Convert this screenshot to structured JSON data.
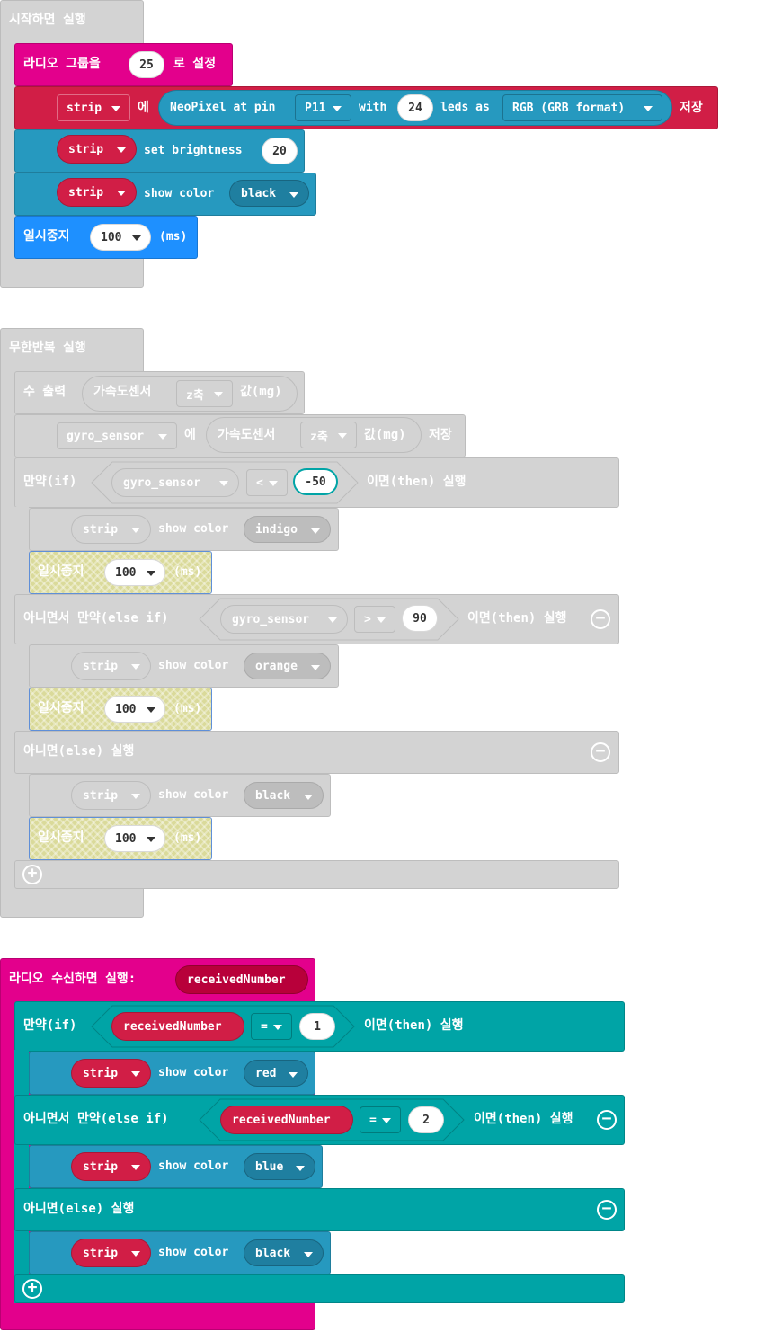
{
  "start_block": {
    "title": "시작하면 실행",
    "radio_group": {
      "label": "라디오 그룹을",
      "value": "25",
      "suffix": "로 설정"
    },
    "neopixel": {
      "var": "strip",
      "to": "에",
      "create": "NeoPixel at pin",
      "pin": "P11",
      "with": "with",
      "count": "24",
      "leds_as": "leds as",
      "format": "RGB (GRB format)",
      "store": "저장"
    },
    "brightness": {
      "var": "strip",
      "text": "set brightness",
      "value": "20"
    },
    "show_color": {
      "var": "strip",
      "text": "show color",
      "color": "black"
    },
    "pause": {
      "label": "일시중지",
      "value": "100",
      "unit": "(ms)"
    }
  },
  "forever_block": {
    "title": "무한반복 실행",
    "print": {
      "label": "수 출력",
      "sensor": "가속도센서",
      "axis": "z축",
      "unit": "값(mg)"
    },
    "assign": {
      "var": "gyro_sensor",
      "to": "에",
      "sensor": "가속도센서",
      "axis": "z축",
      "unit": "값(mg)",
      "store": "저장"
    },
    "if": {
      "label": "만약(if)",
      "var": "gyro_sensor",
      "op": "<",
      "value": "-50",
      "then": "이면(then) 실행"
    },
    "if_color": {
      "var": "strip",
      "text": "show color",
      "color": "indigo"
    },
    "pause1": {
      "label": "일시중지",
      "value": "100",
      "unit": "(ms)"
    },
    "elseif": {
      "label": "아니면서 만약(else if)",
      "var": "gyro_sensor",
      "op": ">",
      "value": "90",
      "then": "이면(then) 실행"
    },
    "elseif_color": {
      "var": "strip",
      "text": "show color",
      "color": "orange"
    },
    "pause2": {
      "label": "일시중지",
      "value": "100",
      "unit": "(ms)"
    },
    "else": {
      "label": "아니면(else) 실행"
    },
    "else_color": {
      "var": "strip",
      "text": "show color",
      "color": "black"
    },
    "pause3": {
      "label": "일시중지",
      "value": "100",
      "unit": "(ms)"
    }
  },
  "radio_block": {
    "title": "라디오 수신하면 실행:",
    "param": "receivedNumber",
    "if": {
      "label": "만약(if)",
      "var": "receivedNumber",
      "op": "=",
      "value": "1",
      "then": "이면(then) 실행"
    },
    "if_color": {
      "var": "strip",
      "text": "show color",
      "color": "red"
    },
    "elseif": {
      "label": "아니면서 만약(else if)",
      "var": "receivedNumber",
      "op": "=",
      "value": "2",
      "then": "이면(then) 실행"
    },
    "elseif_color": {
      "var": "strip",
      "text": "show color",
      "color": "blue"
    },
    "else": {
      "label": "아니면(else) 실행"
    },
    "else_color": {
      "var": "strip",
      "text": "show color",
      "color": "black"
    }
  },
  "icons": {
    "remove": "minus-circle-icon",
    "add": "plus-circle-icon",
    "dropdown": "chevron-down-icon"
  },
  "colors": {
    "event_grey": "#d3d3d3",
    "radio_magenta": "#e3008c",
    "neopixel_blue": "#2699bf",
    "strip_red": "#d11e46",
    "pause_blue": "#1e90ff",
    "logic_teal": "#00a4a6",
    "disabled_grey": "#cfcfcf"
  }
}
